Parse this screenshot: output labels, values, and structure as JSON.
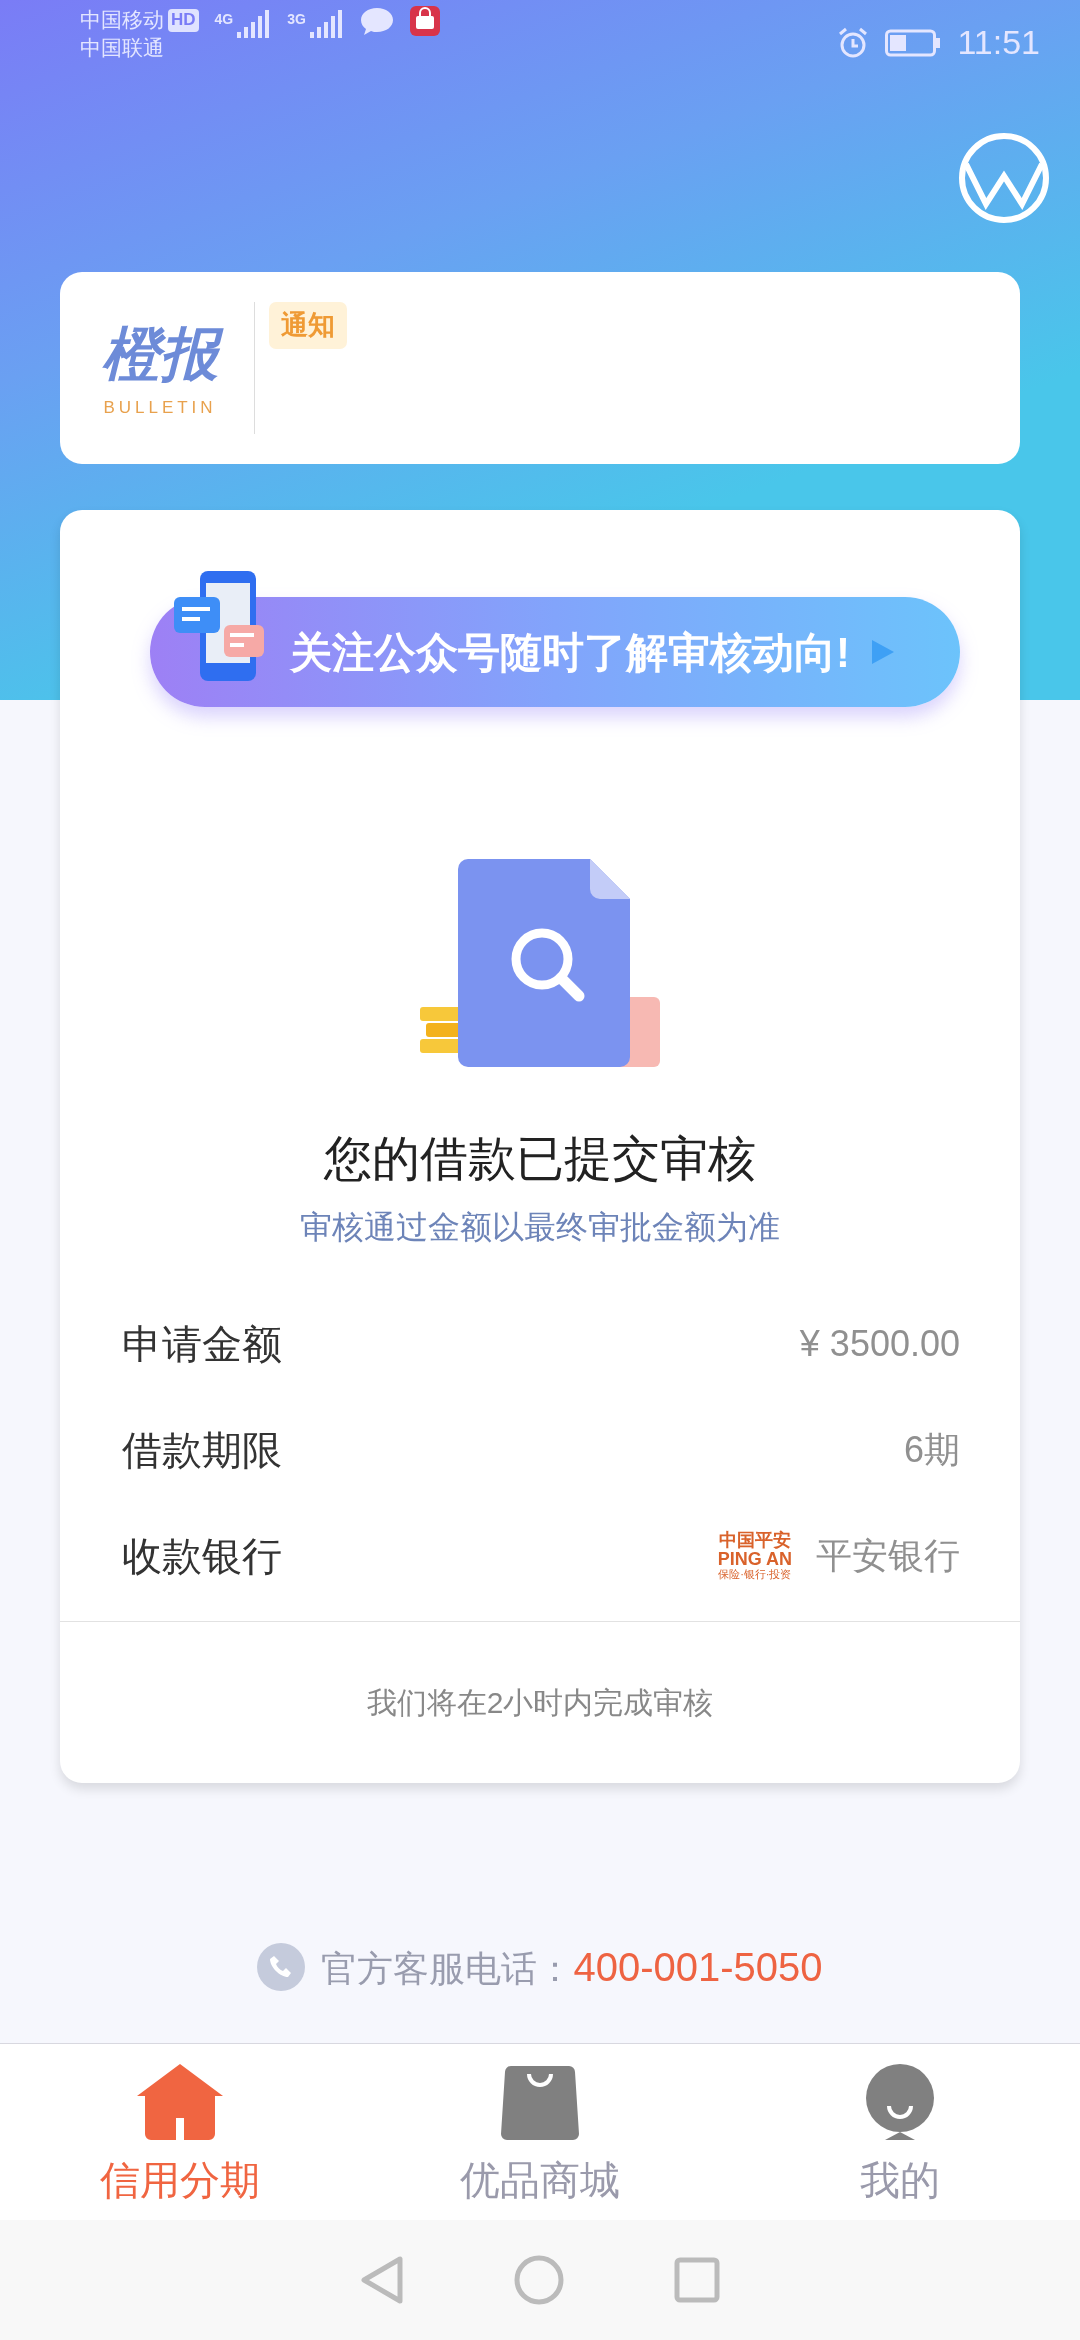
{
  "status_bar": {
    "carrier_1": "中国移动",
    "hd_badge": "HD",
    "network_1": "4G",
    "network_2": "3G",
    "carrier_2": "中国联通",
    "time": "11:51"
  },
  "bulletin": {
    "logo_title": "橙报",
    "logo_subtitle": "BULLETIN",
    "tag": "通知"
  },
  "banner": {
    "text": "关注公众号随时了解审核动向!"
  },
  "review": {
    "title": "您的借款已提交审核",
    "subtitle": "审核通过金额以最终审批金额为准",
    "details": [
      {
        "kind": "text",
        "label": "申请金额",
        "value": "¥ 3500.00"
      },
      {
        "kind": "text",
        "label": "借款期限",
        "value": "6期"
      },
      {
        "kind": "bank",
        "label": "收款银行",
        "value": "平安银行",
        "bank_logo": [
          "中国平安",
          "PING AN",
          "保险·银行·投资"
        ]
      }
    ],
    "footer": "我们将在2小时内完成审核"
  },
  "hotline": {
    "label": "官方客服电话：",
    "number": "400-001-5050"
  },
  "bottom_nav": [
    {
      "kind": "home",
      "label": "信用分期",
      "selected": true
    },
    {
      "kind": "shop",
      "label": "优品商城",
      "selected": false
    },
    {
      "kind": "profile",
      "label": "我的",
      "selected": false
    }
  ]
}
